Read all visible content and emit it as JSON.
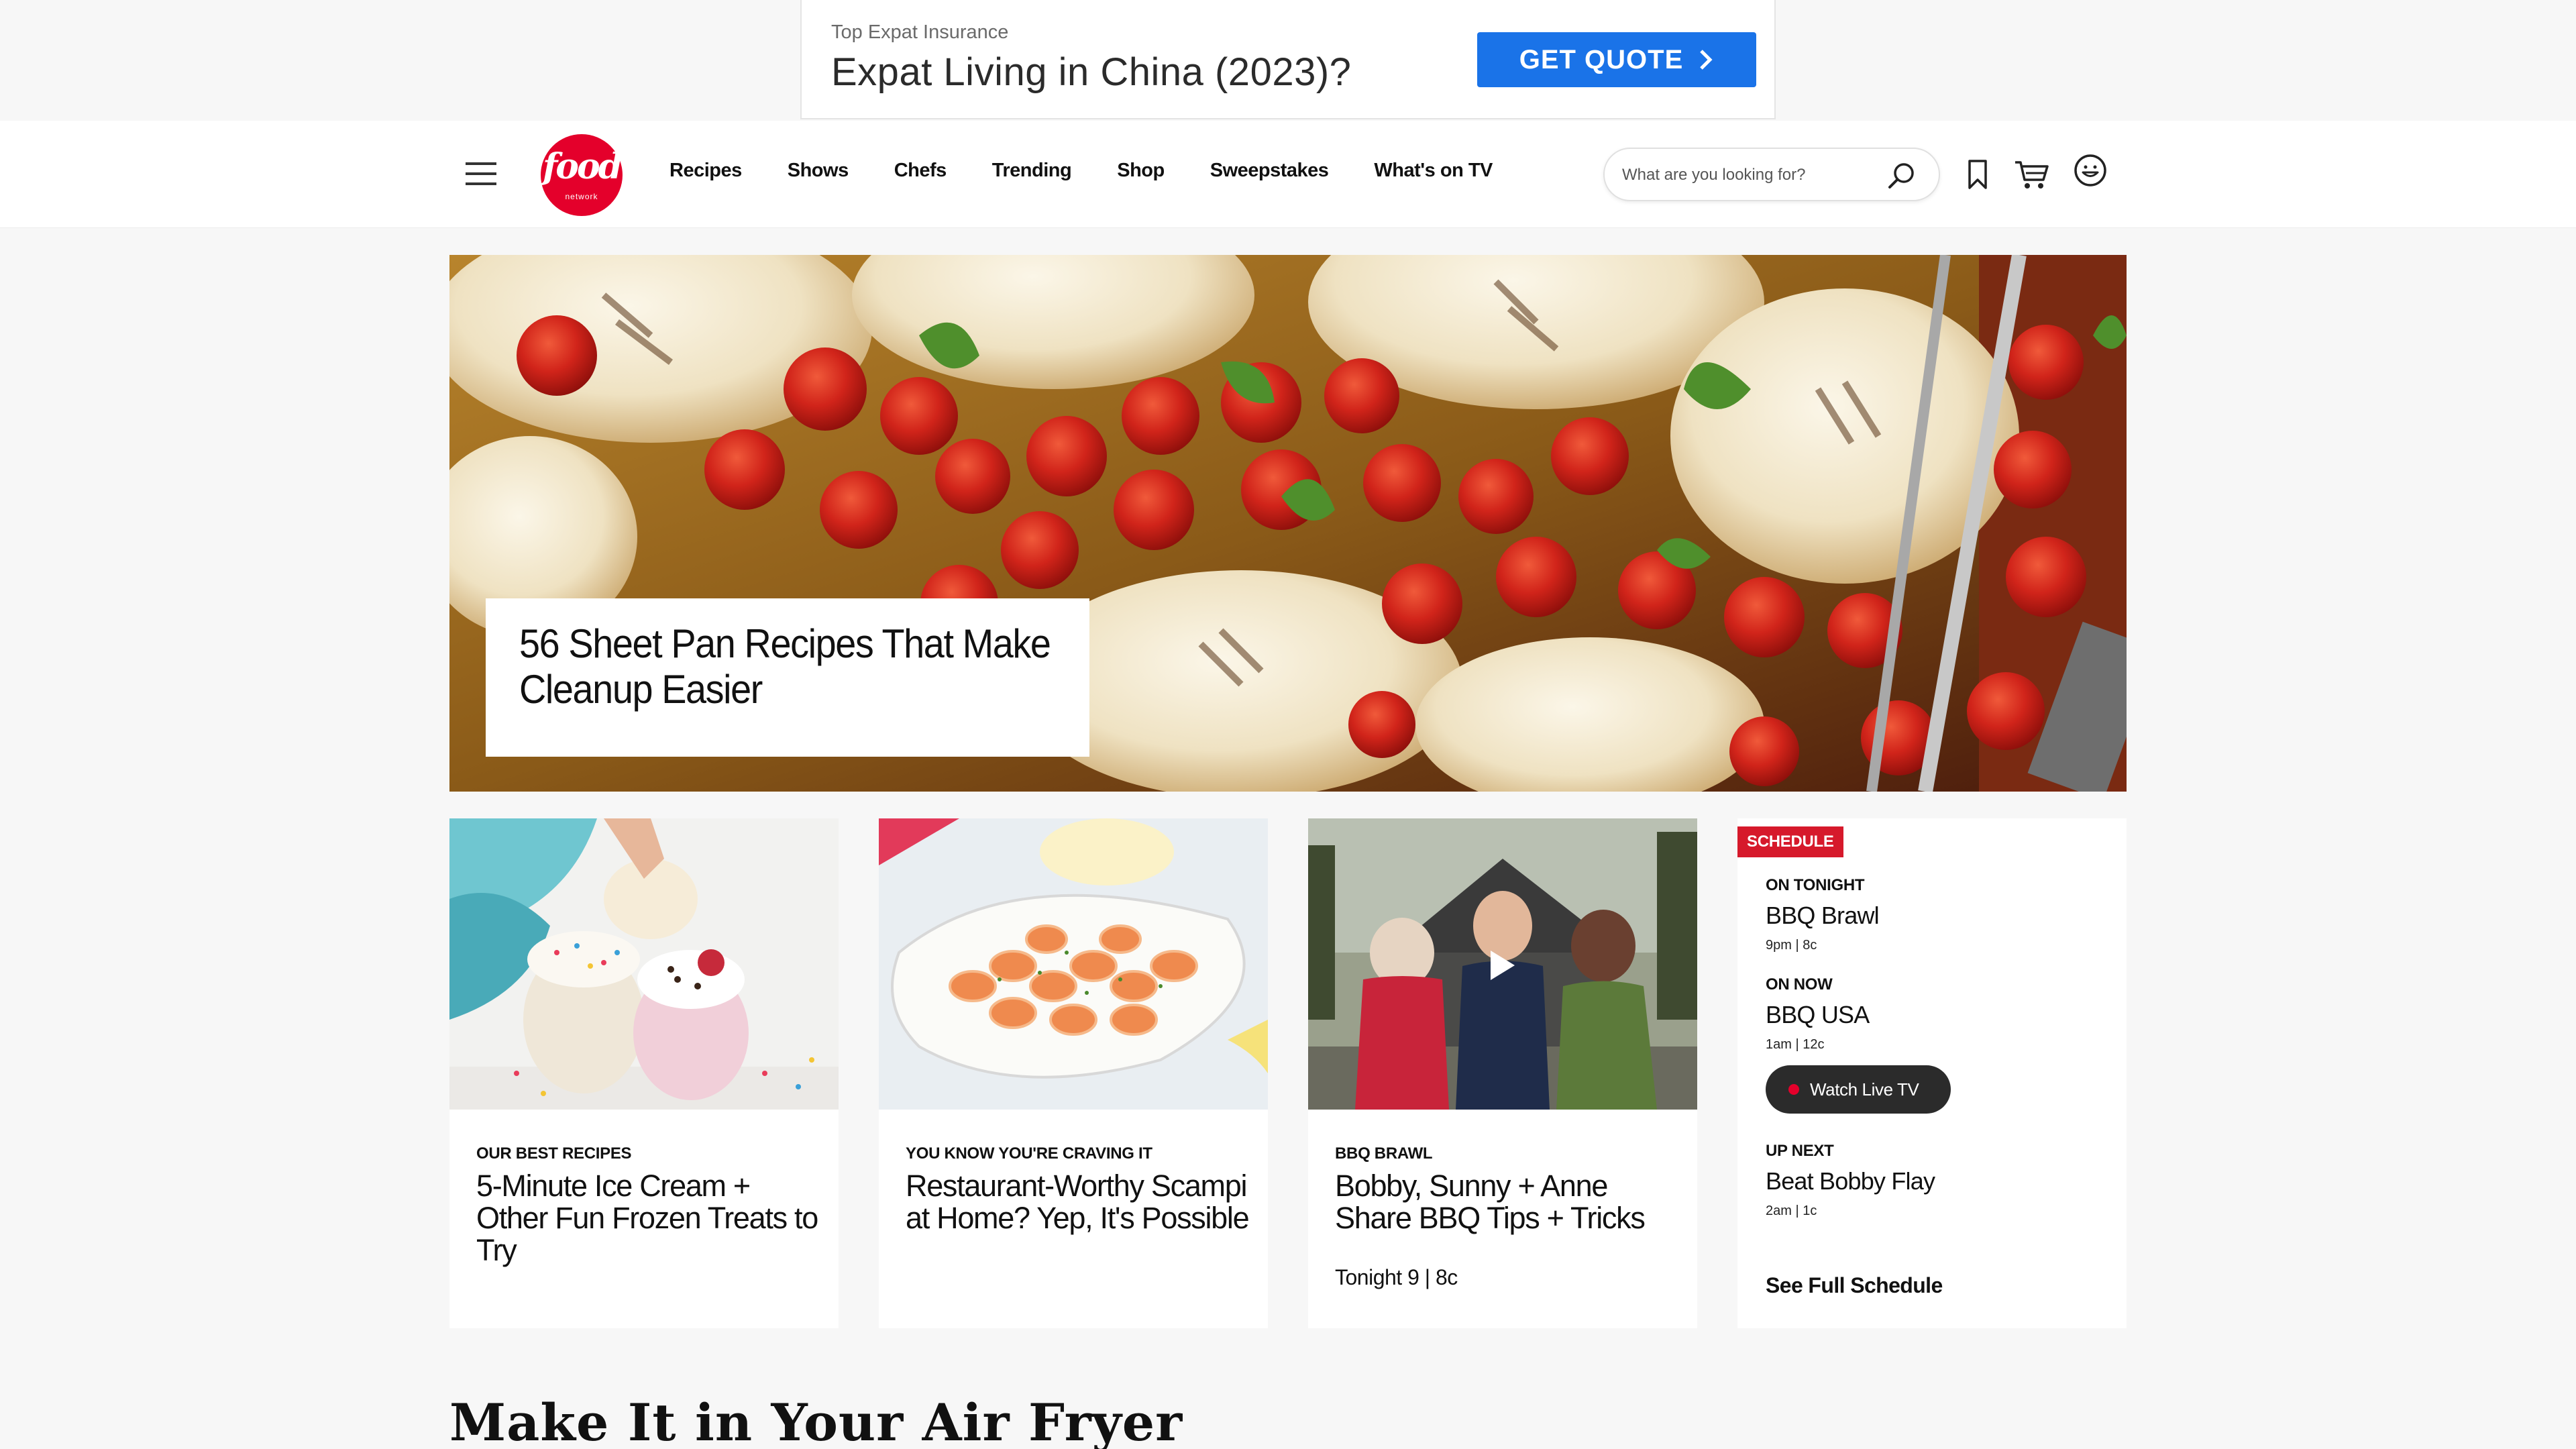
{
  "ad": {
    "sponsor": "Top Expat Insurance",
    "headline": "Expat Living in China (2023)?",
    "cta": "GET QUOTE"
  },
  "header": {
    "logo_word": "food",
    "logo_sub": "network",
    "nav": [
      "Recipes",
      "Shows",
      "Chefs",
      "Trending",
      "Shop",
      "Sweepstakes",
      "What's on TV"
    ],
    "search_placeholder": "What are you looking for?"
  },
  "hero": {
    "title": "56 Sheet Pan Recipes That Make Cleanup Easier"
  },
  "cards": [
    {
      "eyebrow": "OUR BEST RECIPES",
      "title": "5-Minute Ice Cream + Other Fun Frozen Treats to Try"
    },
    {
      "eyebrow": "YOU KNOW YOU'RE CRAVING IT",
      "title": "Restaurant-Worthy Scampi at Home? Yep, It's Possible"
    },
    {
      "eyebrow": "BBQ BRAWL",
      "title": "Bobby, Sunny + Anne Share BBQ Tips + Tricks",
      "extra": "Tonight 9 | 8c"
    }
  ],
  "schedule": {
    "badge": "SCHEDULE",
    "on_tonight": {
      "label": "ON TONIGHT",
      "show": "BBQ Brawl",
      "time": "9pm  |  8c"
    },
    "on_now": {
      "label": "ON NOW",
      "show": "BBQ USA",
      "time": "1am  |  12c"
    },
    "watch_live": "Watch Live TV",
    "up_next": {
      "label": "UP NEXT",
      "show": "Beat Bobby Flay",
      "time": "2am  |  1c"
    },
    "full_schedule": "See Full Schedule"
  },
  "section": {
    "title": "Make It in Your Air Fryer"
  },
  "colors": {
    "brand_red": "#e4002b",
    "ad_blue": "#1a73e8",
    "badge_red": "#d6192b"
  }
}
